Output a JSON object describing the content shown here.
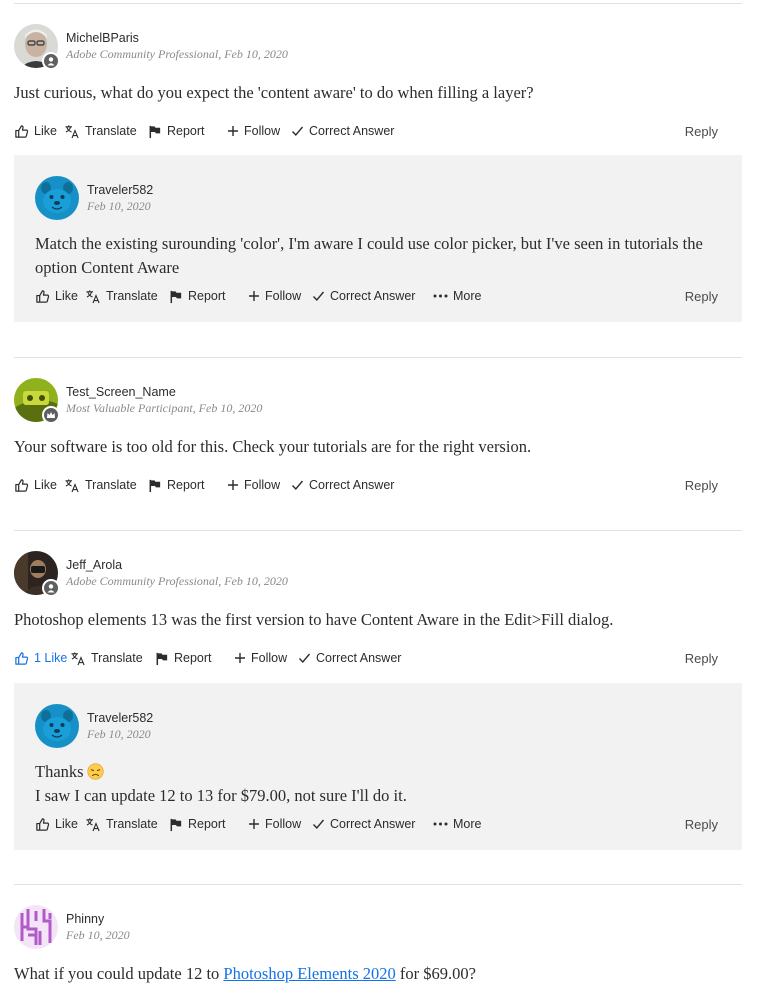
{
  "actions": {
    "like": "Like",
    "translate": "Translate",
    "report": "Report",
    "follow": "Follow",
    "correct_answer": "Correct Answer",
    "more": "More",
    "reply": "Reply"
  },
  "posts": [
    {
      "username": "MichelBParis",
      "meta": "Adobe Community Professional, Feb 10, 2020",
      "body": "Just curious, what do you expect the 'content aware' to do when filling a layer?"
    },
    {
      "username": "Traveler582",
      "meta": "Feb 10, 2020",
      "body": "Match the existing surounding 'color', I'm aware I could use color picker, but I've seen in tutorials the option Content Aware"
    },
    {
      "username": "Test_Screen_Name",
      "meta": "Most Valuable Participant, Feb 10, 2020",
      "body": "Your software is too old for this. Check your tutorials are for the right version."
    },
    {
      "username": "Jeff_Arola",
      "meta": "Adobe Community Professional, Feb 10, 2020",
      "body": "Photoshop elements 13 was the first version to have Content Aware in the Edit>Fill dialog.",
      "like_label": "1 Like"
    },
    {
      "username": "Traveler582",
      "meta": "Feb 10, 2020",
      "body_line1": "Thanks",
      "emoji": "disappointed-face",
      "body_line2": "I saw I can update 12 to 13 for $79.00, not sure I'll do it."
    },
    {
      "username": "Phinny",
      "meta": "Feb 10, 2020",
      "body_before": "What if you could update 12 to ",
      "body_link": "Photoshop Elements 2020",
      "body_after": " for $69.00?"
    }
  ],
  "colors": {
    "link": "#1473e6",
    "reply_background": "#f2f2f2",
    "divider": "#e1e1e1"
  }
}
